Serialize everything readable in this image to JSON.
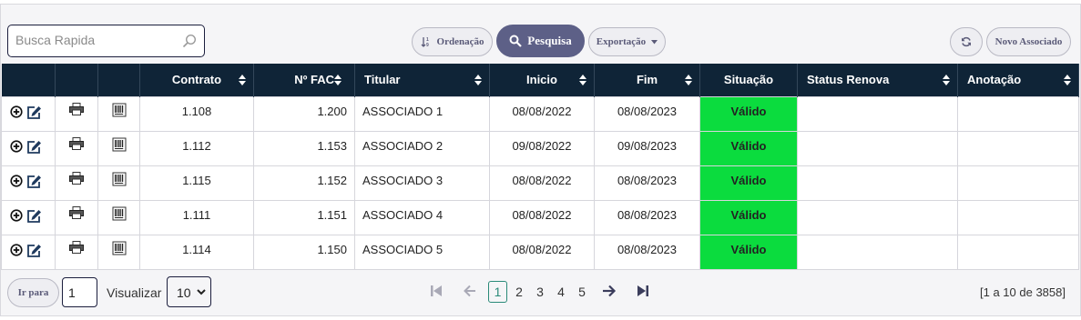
{
  "search": {
    "placeholder": "Busca Rapida"
  },
  "toolbar": {
    "ordenacao_label": "Ordenação",
    "pesquisa_label": "Pesquisa",
    "exportacao_label": "Exportação",
    "novo_label": "Novo Associado"
  },
  "table": {
    "headers": [
      "Contrato",
      "Nº FAC",
      "Titular",
      "Inicio",
      "Fim",
      "Situação",
      "Status Renova",
      "Anotação"
    ],
    "rows": [
      {
        "contrato": "1.108",
        "fac": "1.200",
        "titular": "ASSOCIADO 1",
        "inicio": "08/08/2022",
        "fim": "08/08/2023",
        "situacao": "Válido",
        "status_renova": "",
        "anotacao": ""
      },
      {
        "contrato": "1.112",
        "fac": "1.153",
        "titular": "ASSOCIADO 2",
        "inicio": "09/08/2022",
        "fim": "09/08/2023",
        "situacao": "Válido",
        "status_renova": "",
        "anotacao": ""
      },
      {
        "contrato": "1.115",
        "fac": "1.152",
        "titular": "ASSOCIADO 3",
        "inicio": "08/08/2022",
        "fim": "08/08/2023",
        "situacao": "Válido",
        "status_renova": "",
        "anotacao": ""
      },
      {
        "contrato": "1.111",
        "fac": "1.151",
        "titular": "ASSOCIADO 4",
        "inicio": "08/08/2022",
        "fim": "08/08/2023",
        "situacao": "Válido",
        "status_renova": "",
        "anotacao": ""
      },
      {
        "contrato": "1.114",
        "fac": "1.150",
        "titular": "ASSOCIADO 5",
        "inicio": "08/08/2022",
        "fim": "08/08/2023",
        "situacao": "Válido",
        "status_renova": "",
        "anotacao": ""
      }
    ]
  },
  "pager": {
    "ir_para_label": "Ir para",
    "page_input": "1",
    "visualizar_label": "Visualizar",
    "page_size": "10",
    "pages": [
      "1",
      "2",
      "3",
      "4",
      "5"
    ],
    "current_page": "1",
    "summary": "[1 a 10 de 3858]"
  },
  "colors": {
    "header_bg": "#0f2437",
    "valid_green": "#0bdc3e",
    "accent": "#5d6087",
    "topbar": "#1b1e3d"
  }
}
